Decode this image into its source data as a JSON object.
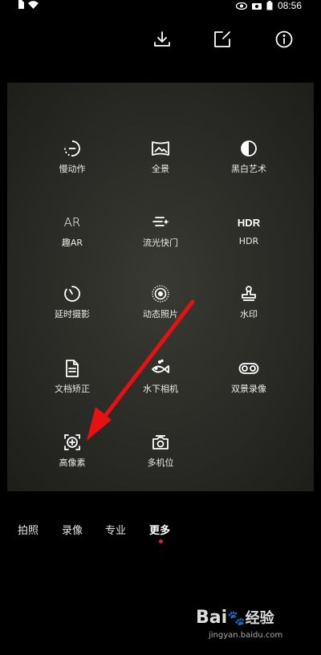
{
  "status_bar": {
    "time": "08:56"
  },
  "toolbar": {
    "download_icon": "download-icon",
    "edit_icon": "edit-icon",
    "info_icon": "info-icon"
  },
  "modes": [
    {
      "label": "慢动作",
      "icon": "slow-motion-icon"
    },
    {
      "label": "全景",
      "icon": "panorama-icon"
    },
    {
      "label": "黑白艺术",
      "icon": "monochrome-icon"
    },
    {
      "label": "趣AR",
      "icon": "ar-icon",
      "glyph": "AR"
    },
    {
      "label": "流光快门",
      "icon": "light-painting-icon"
    },
    {
      "label": "HDR",
      "icon": "hdr-icon",
      "glyph": "HDR"
    },
    {
      "label": "延时摄影",
      "icon": "time-lapse-icon"
    },
    {
      "label": "动态照片",
      "icon": "moving-picture-icon"
    },
    {
      "label": "水印",
      "icon": "watermark-stamp-icon"
    },
    {
      "label": "文档矫正",
      "icon": "document-icon"
    },
    {
      "label": "水下相机",
      "icon": "underwater-fish-icon"
    },
    {
      "label": "双景录像",
      "icon": "dual-view-icon"
    },
    {
      "label": "高像素",
      "icon": "high-resolution-icon"
    },
    {
      "label": "多机位",
      "icon": "multi-camera-icon"
    }
  ],
  "tabs": [
    {
      "label": "拍照",
      "active": false
    },
    {
      "label": "录像",
      "active": false
    },
    {
      "label": "专业",
      "active": false
    },
    {
      "label": "更多",
      "active": true
    }
  ],
  "colors": {
    "accent": "#e0203a",
    "arrow": "#e81010"
  },
  "watermark": {
    "brand": "Bai",
    "brand_cn": "经验",
    "url": "jingyan.baidu.com"
  }
}
